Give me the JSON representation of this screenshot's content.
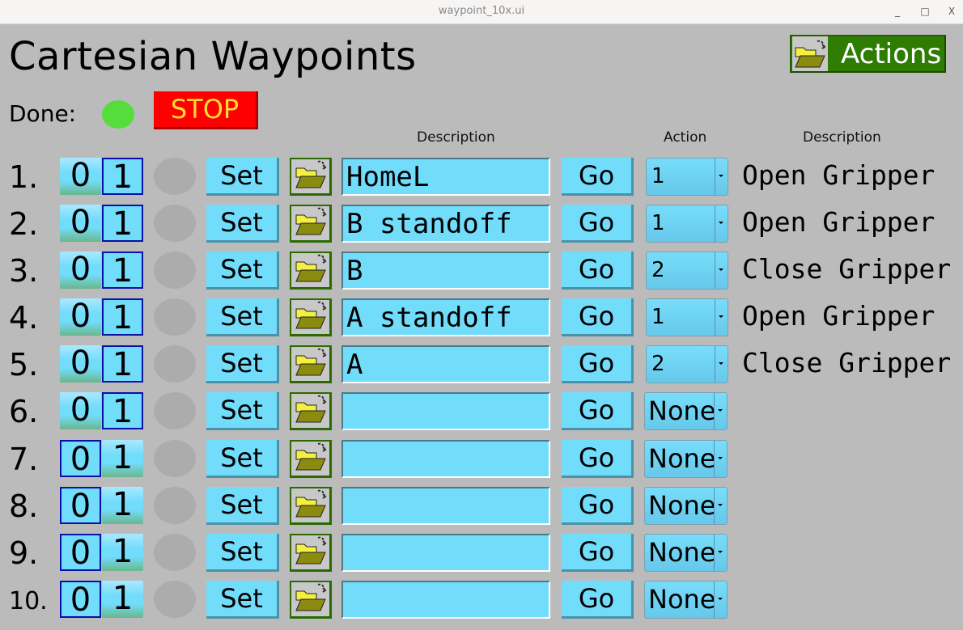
{
  "window": {
    "title": "waypoint_10x.ui",
    "minimize_label": "_",
    "maximize_label": "□",
    "close_label": "X"
  },
  "header": {
    "title": "Cartesian Waypoints",
    "actions_label": "Actions",
    "actions_icon": "folder-open-icon"
  },
  "status": {
    "done_label": "Done:",
    "done_led_color": "#55dd3b",
    "stop_label": "STOP",
    "stop_color": "#ff0000"
  },
  "columns": {
    "description": "Description",
    "action": "Action",
    "action_description": "Description"
  },
  "colors": {
    "button_bg": "#72dcfb",
    "led_off": "#acacac",
    "active_border": "#0a10a8",
    "actions_bg": "#2e7c02"
  },
  "rows": [
    {
      "num": "1.",
      "bit0": "0",
      "bit1": "1",
      "active_bit": 1,
      "set": "Set",
      "description": "HomeL",
      "go": "Go",
      "action": "1",
      "action_desc": "Open Gripper"
    },
    {
      "num": "2.",
      "bit0": "0",
      "bit1": "1",
      "active_bit": 1,
      "set": "Set",
      "description": "B standoff",
      "go": "Go",
      "action": "1",
      "action_desc": "Open Gripper"
    },
    {
      "num": "3.",
      "bit0": "0",
      "bit1": "1",
      "active_bit": 1,
      "set": "Set",
      "description": "B",
      "go": "Go",
      "action": "2",
      "action_desc": "Close Gripper"
    },
    {
      "num": "4.",
      "bit0": "0",
      "bit1": "1",
      "active_bit": 1,
      "set": "Set",
      "description": "A standoff",
      "go": "Go",
      "action": "1",
      "action_desc": "Open Gripper"
    },
    {
      "num": "5.",
      "bit0": "0",
      "bit1": "1",
      "active_bit": 1,
      "set": "Set",
      "description": "A",
      "go": "Go",
      "action": "2",
      "action_desc": "Close Gripper"
    },
    {
      "num": "6.",
      "bit0": "0",
      "bit1": "1",
      "active_bit": 1,
      "set": "Set",
      "description": "",
      "go": "Go",
      "action": "None",
      "action_desc": ""
    },
    {
      "num": "7.",
      "bit0": "0",
      "bit1": "1",
      "active_bit": 0,
      "set": "Set",
      "description": "",
      "go": "Go",
      "action": "None",
      "action_desc": ""
    },
    {
      "num": "8.",
      "bit0": "0",
      "bit1": "1",
      "active_bit": 0,
      "set": "Set",
      "description": "",
      "go": "Go",
      "action": "None",
      "action_desc": ""
    },
    {
      "num": "9.",
      "bit0": "0",
      "bit1": "1",
      "active_bit": 0,
      "set": "Set",
      "description": "",
      "go": "Go",
      "action": "None",
      "action_desc": ""
    },
    {
      "num": "10.",
      "bit0": "0",
      "bit1": "1",
      "active_bit": 0,
      "set": "Set",
      "description": "",
      "go": "Go",
      "action": "None",
      "action_desc": ""
    }
  ]
}
